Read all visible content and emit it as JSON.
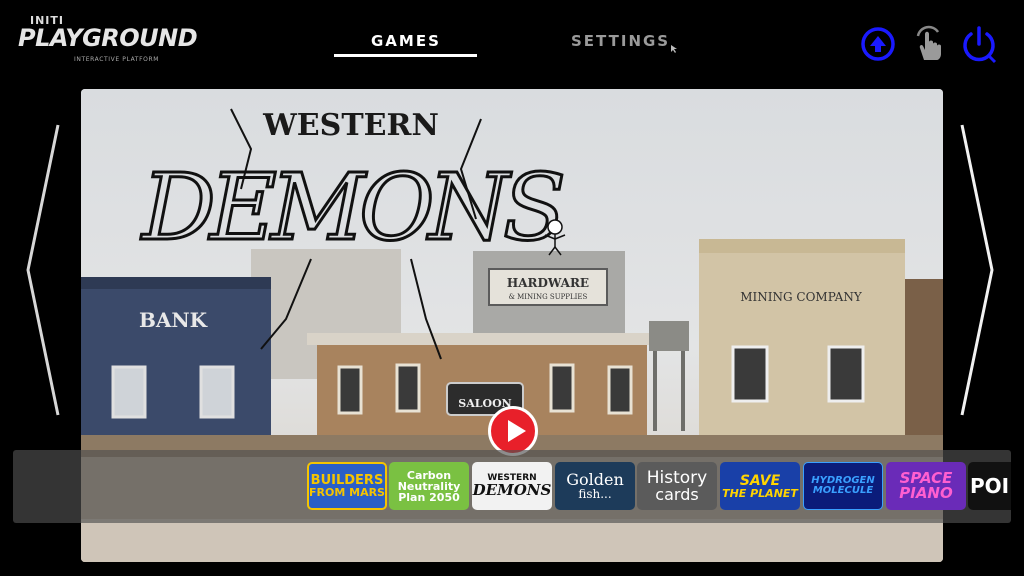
{
  "brand": {
    "small": "INITI",
    "name": "PLAYGROUND",
    "subtitle": "INTERACTIVE PLATFORM"
  },
  "nav": {
    "tabs": [
      "GAMES",
      "SETTINGS"
    ],
    "active": "GAMES"
  },
  "top_icons": [
    "upload-icon",
    "touch-icon",
    "power-icon"
  ],
  "accent_color": "#1a1aff",
  "hero": {
    "game_title_top": "WESTERN",
    "game_title_logo": "DEMONS",
    "signs": {
      "bank": "BANK",
      "hardware": "HARDWARE",
      "hardware_sub": "& MINING SUPPLIES",
      "saloon": "SALOON",
      "mining": "MINING COMPANY"
    }
  },
  "games": [
    {
      "line1": "BUILDERS",
      "line2": "FROM MARS",
      "bg": "#2a5fc7",
      "fg": "#f5c400"
    },
    {
      "line1": "Carbon",
      "line2": "Neutrality",
      "line3": "Plan 2050",
      "bg": "#7ac142",
      "fg": "#ffffff"
    },
    {
      "line1": "WESTERN",
      "line2": "DEMONS",
      "bg": "#f2f2f2",
      "fg": "#111111"
    },
    {
      "line1": "Golden",
      "line2": "fish...",
      "bg": "#1d3b5a",
      "fg": "#ffffff"
    },
    {
      "line1": "History",
      "line2": "cards",
      "bg": "#5b5b5b",
      "fg": "#ffffff"
    },
    {
      "line1": "SAVE",
      "line2": "THE PLANET",
      "bg": "#1940a8",
      "fg": "#ffd400"
    },
    {
      "line1": "HYDROGEN",
      "line2": "MOLECULE",
      "bg": "#0b1c7a",
      "fg": "#3aa0ff"
    },
    {
      "line1": "SPACE",
      "line2": "PIANO",
      "bg": "#6a2bb8",
      "fg": "#ff5fd0"
    },
    {
      "line1": "POI",
      "bg": "#111111",
      "fg": "#ffffff"
    }
  ]
}
